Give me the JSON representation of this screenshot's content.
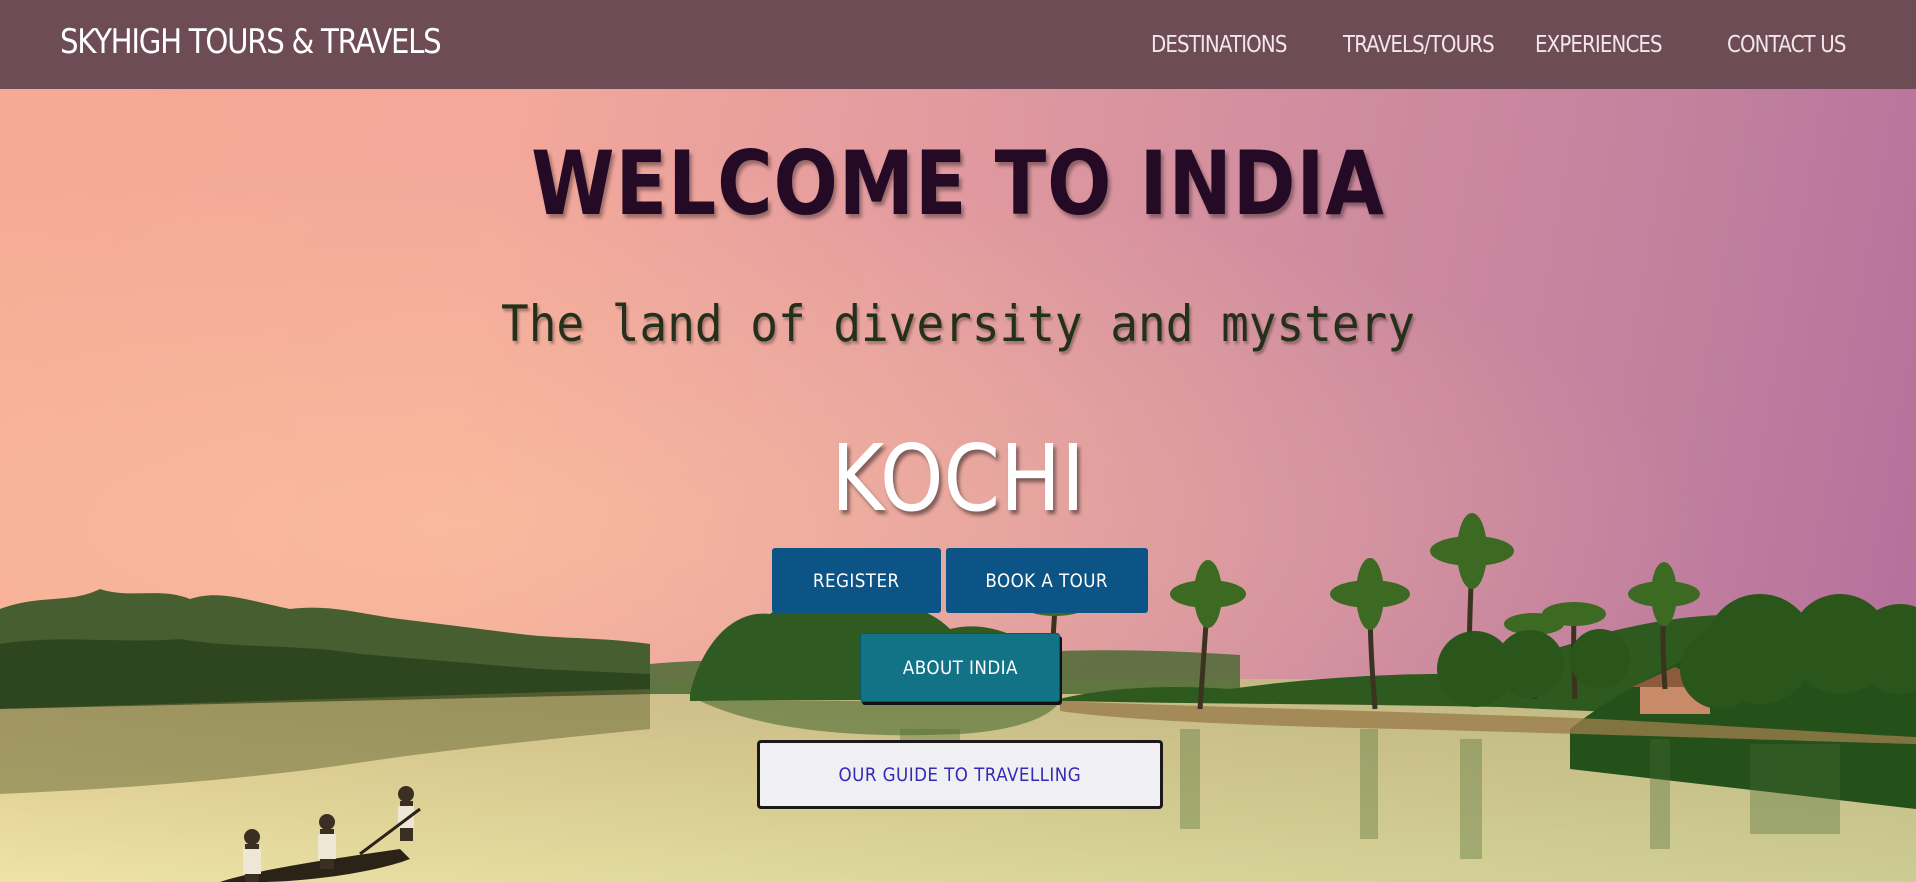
{
  "navbar": {
    "brand": "SKYHIGH TOURS & TRAVELS",
    "items": [
      {
        "label": "DESTINATIONS"
      },
      {
        "label": "TRAVELS/TOURS"
      },
      {
        "label": "EXPERIENCES"
      },
      {
        "label": "CONTACT US"
      }
    ],
    "background_color": "#6e4c56"
  },
  "hero": {
    "title": "WELCOME TO INDIA",
    "subtitle": "The land of diversity and mystery",
    "city": "KOCHI",
    "buttons": {
      "register": "REGISTER",
      "book_tour": "BOOK A TOUR",
      "about": "ABOUT INDIA",
      "guide": "OUR GUIDE TO TRAVELLING"
    },
    "colors": {
      "title": "#250a26",
      "subtitle": "#25301b",
      "primary_button": "#0c5485",
      "about_button": "#137386",
      "guide_text": "#3728b8"
    }
  }
}
